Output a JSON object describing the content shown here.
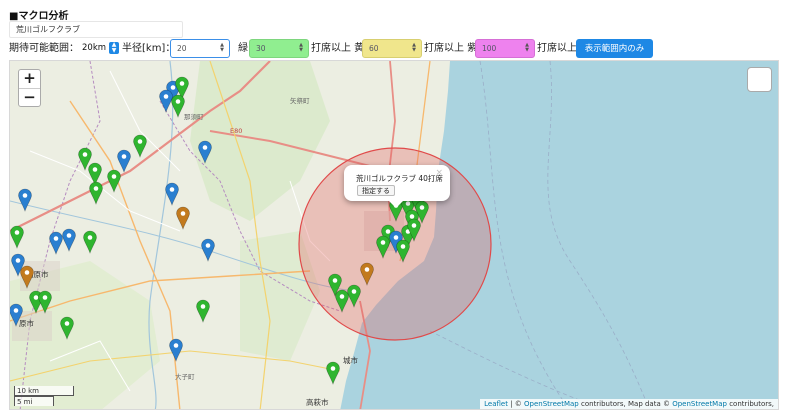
{
  "section": {
    "title": "■マクロ分析"
  },
  "course_name": "荒川ゴルフクラブ",
  "controls": {
    "range_label": "期待可能範囲：",
    "range_value": "20km",
    "radius_label": "半径[km]：",
    "radius_value": "20",
    "green_label": "緑",
    "green_value": "30",
    "yellow_prefix": "打席以上 黄",
    "yellow_value": "60",
    "violet_prefix": "打席以上 紫",
    "violet_value": "100",
    "violet_suffix": "打席以上",
    "visible_button": "表示範囲内のみ"
  },
  "map": {
    "zoom_in": "+",
    "zoom_out": "−",
    "scale_km": "10 km",
    "scale_mi": "5 mi",
    "attribution": {
      "leaflet": "Leaflet",
      "sep1": " | © ",
      "osm1": "OpenStreetMap",
      "mid": " contributors, Map data © ",
      "osm2": "OpenStreetMap",
      "end": " contributors,"
    },
    "popup": {
      "text": "荒川ゴルフクラブ 40打席",
      "button": "指定する",
      "close": "×"
    },
    "place_labels": {
      "shiobara": "塩原市",
      "hara": "原市",
      "jo": "城市",
      "takahagi": "高萩市",
      "nasu": "那須町",
      "ooko": "大子町",
      "yamizo": "矢祭町",
      "e80": "E80"
    },
    "colors": {
      "green_marker": "#2fb52f",
      "blue_marker": "#2a7fd0",
      "orange_marker": "#c27a1e",
      "circle_stroke": "#e04a4a",
      "sea": "#aad3df",
      "land": "#eceee2"
    }
  }
}
